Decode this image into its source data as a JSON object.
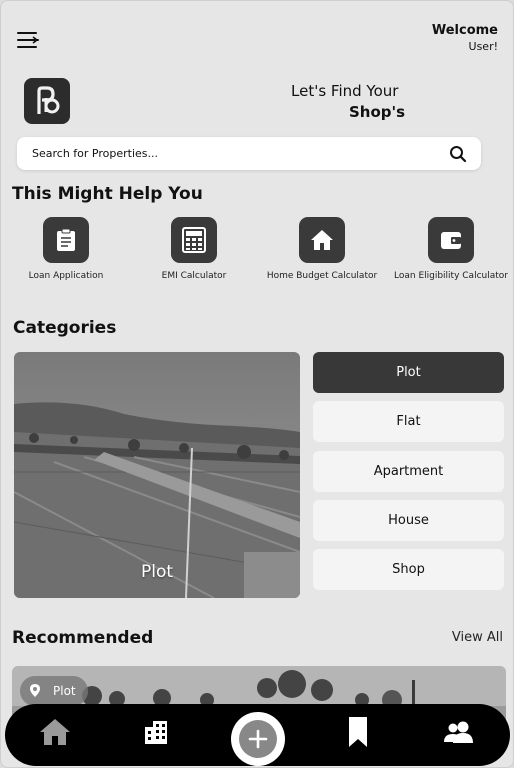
{
  "header": {
    "welcome": "Welcome",
    "user": "User!",
    "tagline_line1": "Let's Find Your",
    "tagline_line2": "Shop's"
  },
  "search": {
    "placeholder": "Search for Properties..."
  },
  "help": {
    "title": "This Might Help You",
    "items": [
      {
        "label": "Loan Application",
        "icon": "clipboard-icon"
      },
      {
        "label": "EMI Calculator",
        "icon": "calculator-icon"
      },
      {
        "label": "Home Budget Calculator",
        "icon": "home-icon"
      },
      {
        "label": "Loan Eligibility Calculator",
        "icon": "wallet-icon"
      }
    ]
  },
  "categories": {
    "title": "Categories",
    "image_caption": "Plot",
    "items": [
      "Plot",
      "Flat",
      "Apartment",
      "House",
      "Shop"
    ],
    "active": "Plot"
  },
  "recommended": {
    "title": "Recommended",
    "view_all": "View All",
    "card_badge": "Plot"
  },
  "nav": {
    "items": [
      "home-icon",
      "building-icon",
      "add-icon",
      "bookmark-icon",
      "users-icon"
    ]
  },
  "colors": {
    "accent_dark": "#383838",
    "background": "#e6e6e6",
    "nav": "#000000"
  }
}
